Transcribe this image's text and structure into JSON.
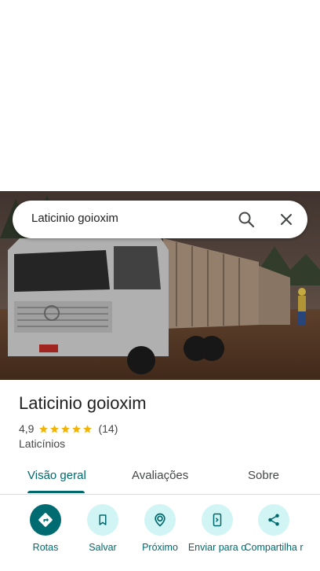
{
  "search": {
    "query": "Laticinio goioxim"
  },
  "place": {
    "name": "Laticinio goioxim",
    "rating": "4,9",
    "stars": 5,
    "reviews": "(14)",
    "category": "Laticínios"
  },
  "tabs": [
    {
      "label": "Visão geral",
      "active": true
    },
    {
      "label": "Avaliações",
      "active": false
    },
    {
      "label": "Sobre",
      "active": false
    }
  ],
  "actions": [
    {
      "label": "Rotas",
      "icon": "directions-icon"
    },
    {
      "label": "Salvar",
      "icon": "bookmark-icon"
    },
    {
      "label": "Próximo",
      "icon": "nearby-icon"
    },
    {
      "label": "Enviar para o",
      "icon": "send-to-phone-icon"
    },
    {
      "label": "Compartilha r",
      "icon": "share-icon"
    }
  ],
  "colors": {
    "accent": "#00696d",
    "star": "#f4b400",
    "chip_bg": "#d1f4f5"
  }
}
